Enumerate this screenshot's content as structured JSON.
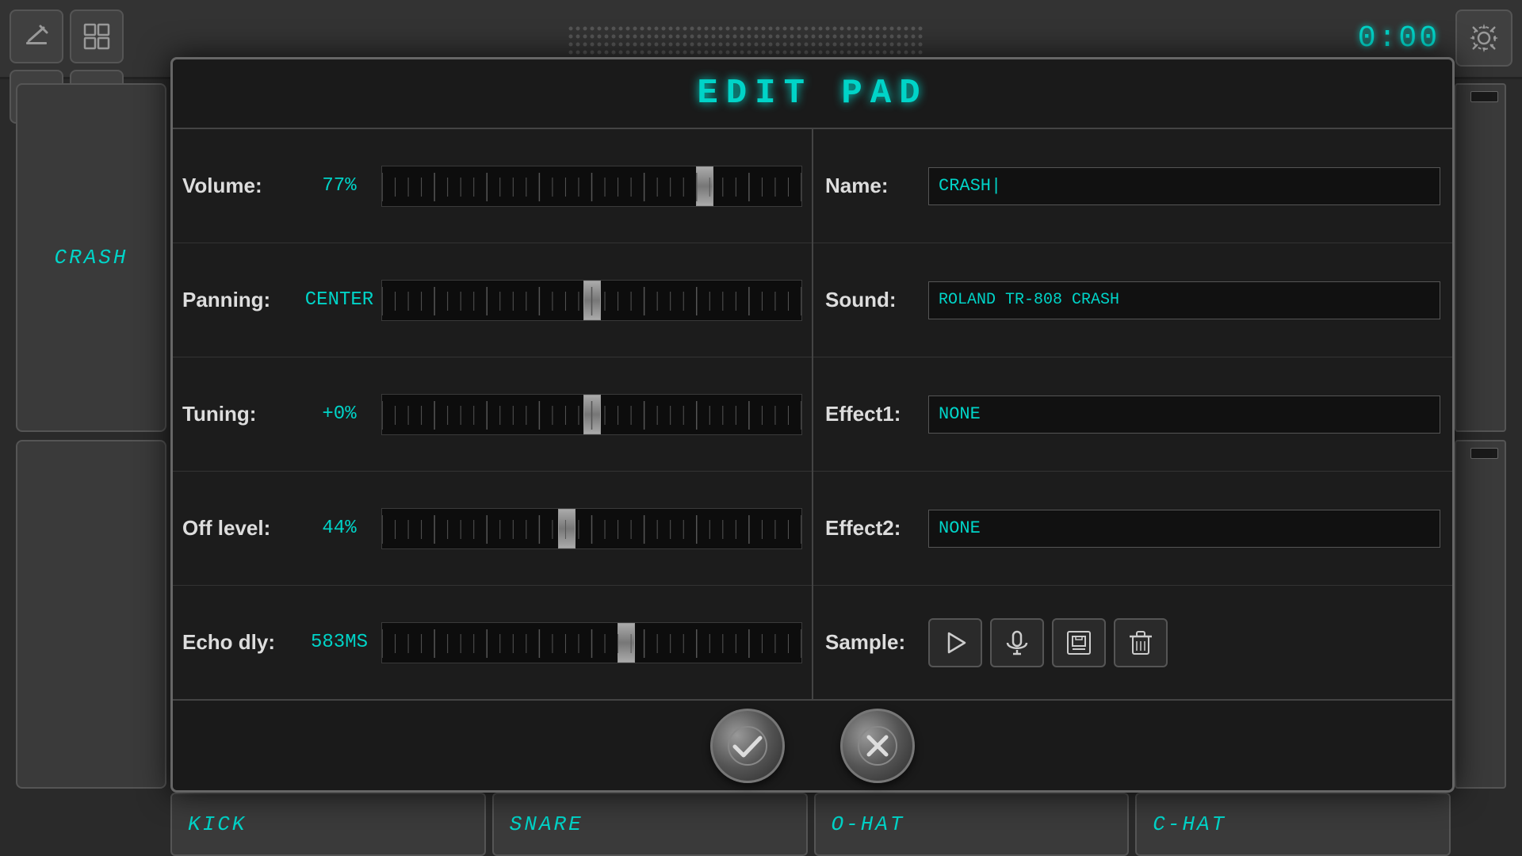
{
  "app": {
    "title": "EDIT PAD",
    "timer": "0:00"
  },
  "topControls": {
    "editIcon": "edit-icon",
    "gridIcon": "grid-icon",
    "circleIcon": "circle-icon",
    "playIcon": "play-icon"
  },
  "gearIcon": "gear-icon",
  "sidePads": {
    "left": {
      "top": {
        "label": "CRASH"
      },
      "bottom": {
        "label": ""
      }
    }
  },
  "bottomPads": [
    {
      "label": "KICK"
    },
    {
      "label": "SNARE"
    },
    {
      "label": "O-HAT"
    },
    {
      "label": "C-HAT"
    }
  ],
  "editPad": {
    "params": {
      "volume": {
        "label": "Volume:",
        "value": "77%",
        "sliderPos": 0.77
      },
      "panning": {
        "label": "Panning:",
        "value": "CENTER",
        "sliderPos": 0.5
      },
      "tuning": {
        "label": "Tuning:",
        "value": "+0%",
        "sliderPos": 0.5
      },
      "offLevel": {
        "label": "Off level:",
        "value": "44%",
        "sliderPos": 0.44
      },
      "echoDly": {
        "label": "Echo dly:",
        "value": "583MS",
        "sliderPos": 0.583
      }
    },
    "rightParams": {
      "name": {
        "label": "Name:",
        "value": "CRASH"
      },
      "sound": {
        "label": "Sound:",
        "value": "ROLAND TR-808 CRASH"
      },
      "effect1": {
        "label": "Effect1:",
        "value": "NONE"
      },
      "effect2": {
        "label": "Effect2:",
        "value": "NONE"
      },
      "sample": {
        "label": "Sample:"
      }
    }
  },
  "buttons": {
    "confirm": "✓",
    "cancel": "✕"
  }
}
